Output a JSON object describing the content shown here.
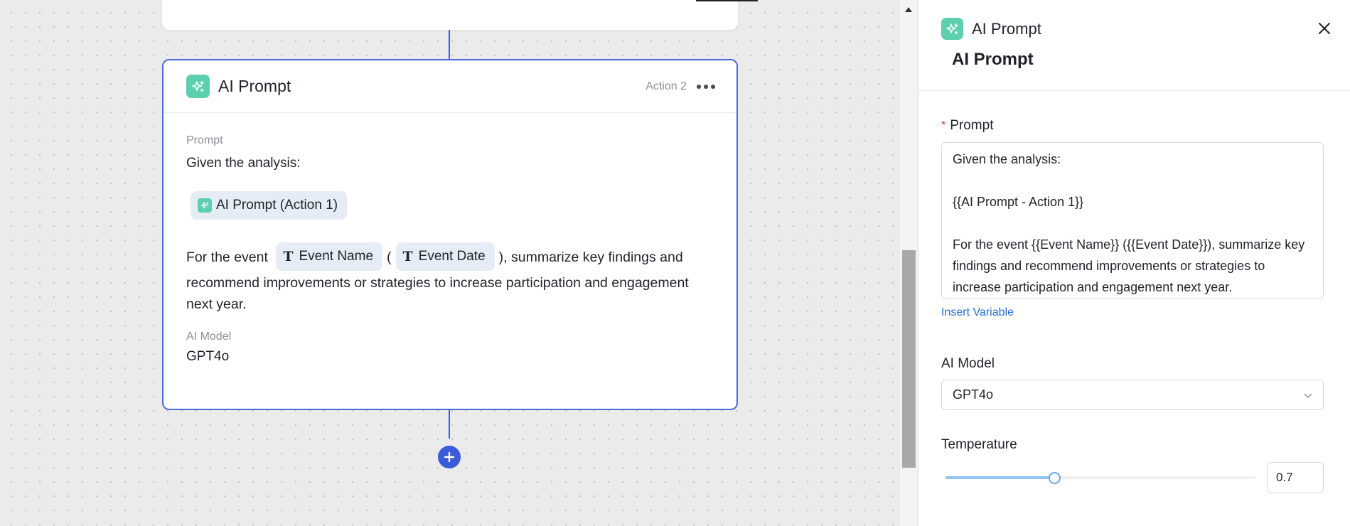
{
  "canvas": {
    "card": {
      "title": "AI Prompt",
      "action_label": "Action 2",
      "prompt_label": "Prompt",
      "prompt_intro": "Given the analysis:",
      "chip_ai_prompt": "AI Prompt (Action 1)",
      "para_prefix": "For the event",
      "chip_event_name": "Event Name",
      "paren_open": "(",
      "chip_event_date": "Event Date",
      "para_suffix": "), summarize key findings and recommend improvements or strategies to increase participation and engagement next year.",
      "model_label": "AI Model",
      "model_value": "GPT4o"
    }
  },
  "panel": {
    "title": "AI Prompt",
    "subtitle": "AI Prompt",
    "prompt_label": "Prompt",
    "required_mark": "*",
    "prompt_text": "Given the analysis:\n\n{{AI Prompt - Action 1}}\n\nFor the event {{Event Name}} ({{Event Date}}), summarize key findings and recommend improvements or strategies to increase participation and engagement next year.",
    "insert_variable": "Insert Variable",
    "model_label": "AI Model",
    "model_value": "GPT4o",
    "temperature_label": "Temperature",
    "temperature_value": "0.7",
    "temperature_fraction": 0.35
  },
  "colors": {
    "accent": "#3b5bdb",
    "ai_icon": "#5ccfae",
    "link": "#1f6fe0",
    "required": "#e53935"
  },
  "icons": {
    "card_icon": "ai-sparkle-icon",
    "close": "close-icon",
    "add": "plus-icon",
    "more": "more-dots-icon",
    "text_var": "text-type-icon",
    "dropdown": "chevron-down-icon"
  }
}
